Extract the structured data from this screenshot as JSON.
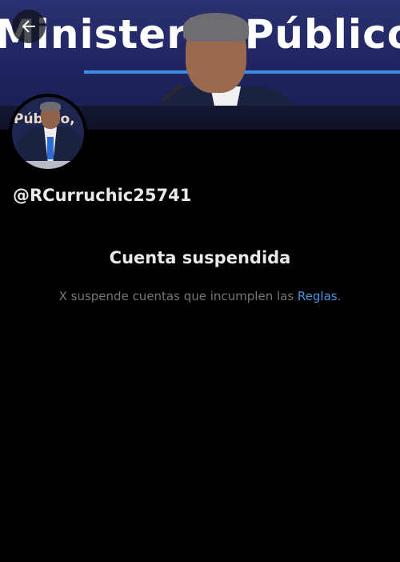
{
  "banner": {
    "text": "Ministerio Público,",
    "colors": {
      "background": "#1f2460",
      "accent_line": "#3d8de3"
    }
  },
  "back_button": {
    "icon": "arrow-left-icon"
  },
  "avatar": {
    "text": "Público,"
  },
  "profile": {
    "handle": "@RCurruchic25741"
  },
  "suspension": {
    "title": "Cuenta suspendida",
    "message": "X suspende cuentas que incumplen las ",
    "rules_link": "Reglas",
    "message_end": "."
  },
  "colors": {
    "background": "#000000",
    "primary_text": "#e7e9ea",
    "secondary_text": "#71767b",
    "link": "#4a95e0"
  }
}
